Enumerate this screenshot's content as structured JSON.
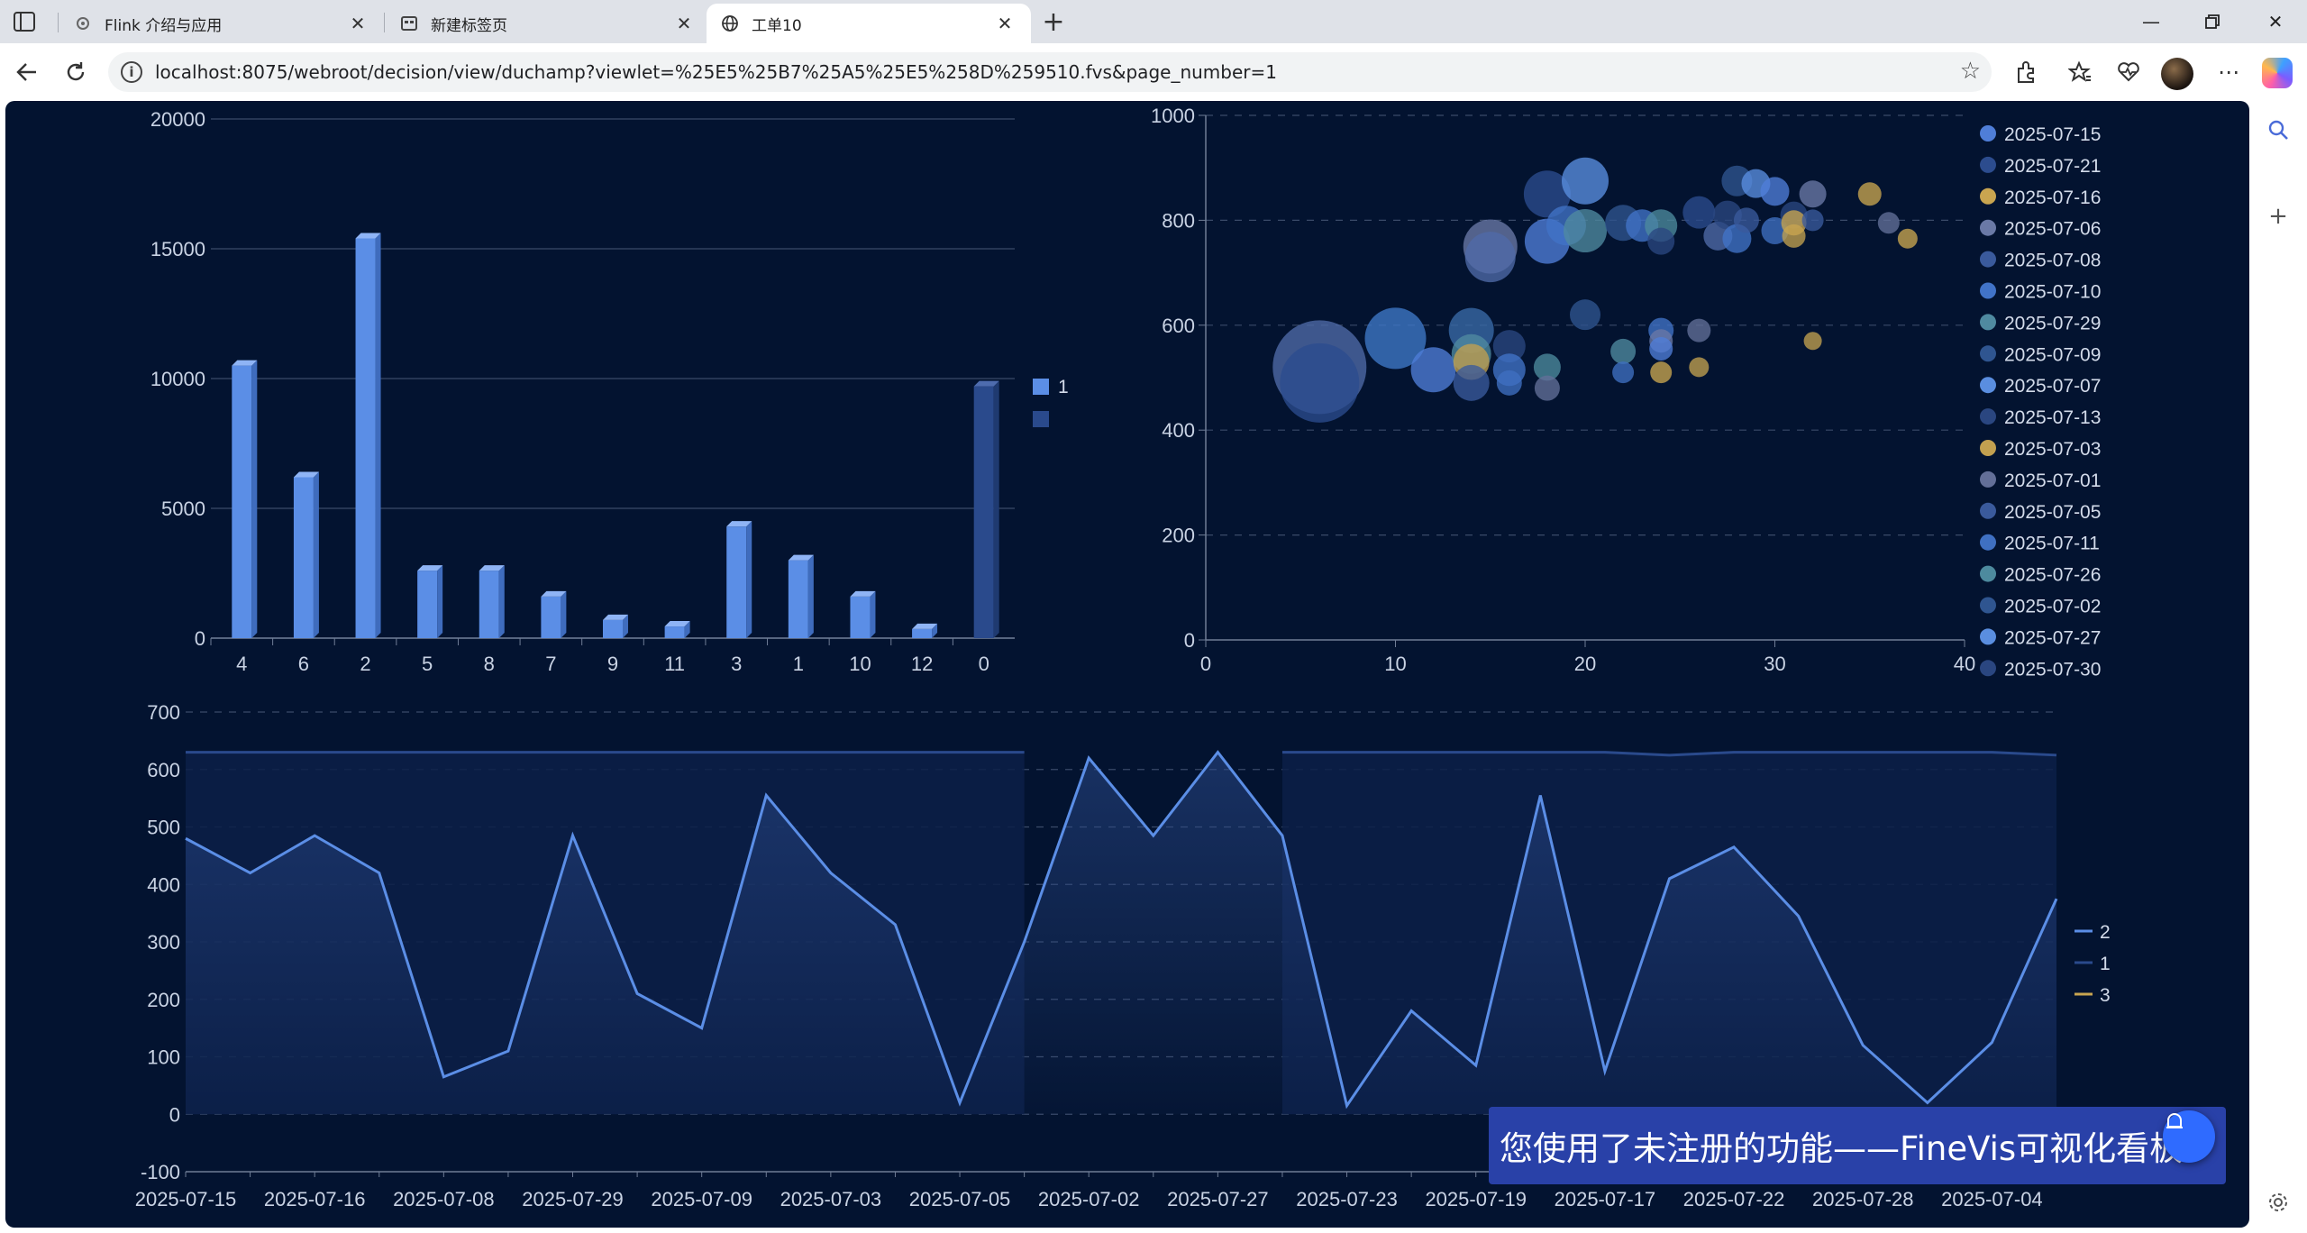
{
  "browser": {
    "tabs": [
      {
        "title": "Flink 介绍与应用",
        "icon": "gear-icon"
      },
      {
        "title": "新建标签页",
        "icon": "newtab-icon"
      },
      {
        "title": "工单10",
        "icon": "globe-icon"
      }
    ],
    "url": "localhost:8075/webroot/decision/view/duchamp?viewlet=%25E5%25B7%25A5%25E5%258D%259510.fvs&page_number=1"
  },
  "watermark": {
    "text": "您使用了未注册的功能——FineVis可视化看板"
  },
  "colors": {
    "background": "#031330",
    "accent": "#5b8ee6",
    "dark_series": "#2a4a8c",
    "gold": "#c9a550"
  },
  "chart_data": [
    {
      "type": "bar",
      "categories": [
        "4",
        "6",
        "2",
        "5",
        "8",
        "7",
        "9",
        "11",
        "3",
        "1",
        "10",
        "12",
        "0"
      ],
      "series": [
        {
          "name": "1",
          "values": [
            10500,
            6200,
            15400,
            2600,
            2600,
            1600,
            700,
            450,
            4300,
            3000,
            1600,
            350,
            null
          ],
          "color": "#5b8ee6"
        },
        {
          "name": "",
          "values": [
            null,
            null,
            null,
            null,
            null,
            null,
            null,
            null,
            null,
            null,
            null,
            null,
            9700
          ],
          "color": "#2a4a8c"
        }
      ],
      "yticks": [
        0,
        5000,
        10000,
        15000,
        20000
      ],
      "ylim": [
        0,
        20000
      ]
    },
    {
      "type": "scatter",
      "xticks": [
        0,
        10,
        20,
        30,
        40
      ],
      "yticks": [
        0,
        200,
        400,
        600,
        800,
        1000
      ],
      "xlim": [
        0,
        40
      ],
      "ylim": [
        0,
        1000
      ],
      "legend": [
        {
          "name": "2025-07-15",
          "color": "#4f7ed8"
        },
        {
          "name": "2025-07-21",
          "color": "#2c4c8e"
        },
        {
          "name": "2025-07-16",
          "color": "#c9a550"
        },
        {
          "name": "2025-07-06",
          "color": "#6a79a6"
        },
        {
          "name": "2025-07-08",
          "color": "#3a5a9c"
        },
        {
          "name": "2025-07-10",
          "color": "#4173c8"
        },
        {
          "name": "2025-07-29",
          "color": "#4f8aa0"
        },
        {
          "name": "2025-07-09",
          "color": "#2f5590"
        },
        {
          "name": "2025-07-07",
          "color": "#5a8ee0"
        },
        {
          "name": "2025-07-13",
          "color": "#2a4680"
        },
        {
          "name": "2025-07-03",
          "color": "#c2a050"
        },
        {
          "name": "2025-07-01",
          "color": "#636f98"
        },
        {
          "name": "2025-07-05",
          "color": "#3a5a9c"
        },
        {
          "name": "2025-07-11",
          "color": "#3f70c2"
        },
        {
          "name": "2025-07-26",
          "color": "#4d8a9e"
        },
        {
          "name": "2025-07-02",
          "color": "#2f5590"
        },
        {
          "name": "2025-07-27",
          "color": "#5a8ee0"
        },
        {
          "name": "2025-07-30",
          "color": "#2a4680"
        }
      ],
      "points": [
        {
          "x": 6,
          "y": 520,
          "s": 52,
          "c": "#4f6aa8"
        },
        {
          "x": 6,
          "y": 490,
          "s": 44,
          "c": "#2c4c8e"
        },
        {
          "x": 10,
          "y": 575,
          "s": 34,
          "c": "#3f78c8"
        },
        {
          "x": 12,
          "y": 515,
          "s": 25,
          "c": "#4f7ed8"
        },
        {
          "x": 14,
          "y": 590,
          "s": 25,
          "c": "#3a6aa8"
        },
        {
          "x": 14,
          "y": 545,
          "s": 22,
          "c": "#4f8aa0"
        },
        {
          "x": 14,
          "y": 530,
          "s": 20,
          "c": "#c2a050"
        },
        {
          "x": 14,
          "y": 490,
          "s": 20,
          "c": "#3a5a9c"
        },
        {
          "x": 16,
          "y": 560,
          "s": 18,
          "c": "#2a4680"
        },
        {
          "x": 16,
          "y": 515,
          "s": 18,
          "c": "#4173c8"
        },
        {
          "x": 16,
          "y": 490,
          "s": 14,
          "c": "#3f70c2"
        },
        {
          "x": 18,
          "y": 520,
          "s": 15,
          "c": "#4d8a9e"
        },
        {
          "x": 18,
          "y": 480,
          "s": 14,
          "c": "#636f98"
        },
        {
          "x": 15,
          "y": 750,
          "s": 30,
          "c": "#6a79a6"
        },
        {
          "x": 15,
          "y": 730,
          "s": 28,
          "c": "#4f6aa8"
        },
        {
          "x": 18,
          "y": 850,
          "s": 26,
          "c": "#2c4c8e"
        },
        {
          "x": 18,
          "y": 760,
          "s": 25,
          "c": "#4f7ed8"
        },
        {
          "x": 20,
          "y": 875,
          "s": 26,
          "c": "#5a8ee0"
        },
        {
          "x": 19,
          "y": 790,
          "s": 22,
          "c": "#4173c8"
        },
        {
          "x": 20,
          "y": 780,
          "s": 24,
          "c": "#4f8aa0"
        },
        {
          "x": 20,
          "y": 620,
          "s": 17,
          "c": "#2f5590"
        },
        {
          "x": 22,
          "y": 795,
          "s": 20,
          "c": "#2f5590"
        },
        {
          "x": 23,
          "y": 790,
          "s": 18,
          "c": "#4173c8"
        },
        {
          "x": 24,
          "y": 790,
          "s": 18,
          "c": "#4d8a9e"
        },
        {
          "x": 24,
          "y": 760,
          "s": 15,
          "c": "#2a4680"
        },
        {
          "x": 22,
          "y": 550,
          "s": 14,
          "c": "#4f8aa0"
        },
        {
          "x": 22,
          "y": 510,
          "s": 12,
          "c": "#3f70c2"
        },
        {
          "x": 24,
          "y": 590,
          "s": 14,
          "c": "#4173c8"
        },
        {
          "x": 24,
          "y": 570,
          "s": 13,
          "c": "#6a79a6"
        },
        {
          "x": 24,
          "y": 555,
          "s": 13,
          "c": "#4f7ed8"
        },
        {
          "x": 24,
          "y": 510,
          "s": 12,
          "c": "#c9a550"
        },
        {
          "x": 26,
          "y": 590,
          "s": 13,
          "c": "#636f98"
        },
        {
          "x": 26,
          "y": 520,
          "s": 11,
          "c": "#c2a050"
        },
        {
          "x": 26,
          "y": 815,
          "s": 18,
          "c": "#2c4c8e"
        },
        {
          "x": 27,
          "y": 770,
          "s": 16,
          "c": "#4f6aa8"
        },
        {
          "x": 27.5,
          "y": 810,
          "s": 16,
          "c": "#2a4680"
        },
        {
          "x": 28,
          "y": 875,
          "s": 17,
          "c": "#2f5590"
        },
        {
          "x": 28,
          "y": 765,
          "s": 16,
          "c": "#4173c8"
        },
        {
          "x": 28.5,
          "y": 800,
          "s": 14,
          "c": "#3a5a9c"
        },
        {
          "x": 29,
          "y": 870,
          "s": 16,
          "c": "#5a8ee0"
        },
        {
          "x": 30,
          "y": 855,
          "s": 16,
          "c": "#4f7ed8"
        },
        {
          "x": 30,
          "y": 780,
          "s": 15,
          "c": "#3f70c2"
        },
        {
          "x": 31,
          "y": 810,
          "s": 15,
          "c": "#2a4680"
        },
        {
          "x": 31,
          "y": 770,
          "s": 13,
          "c": "#c2a050"
        },
        {
          "x": 31,
          "y": 795,
          "s": 14,
          "c": "#c9a550"
        },
        {
          "x": 32,
          "y": 850,
          "s": 15,
          "c": "#6a79a6"
        },
        {
          "x": 32,
          "y": 800,
          "s": 12,
          "c": "#3a5a9c"
        },
        {
          "x": 32,
          "y": 570,
          "s": 10,
          "c": "#c2a050"
        },
        {
          "x": 35,
          "y": 850,
          "s": 13,
          "c": "#c9a550"
        },
        {
          "x": 36,
          "y": 795,
          "s": 12,
          "c": "#636f98"
        },
        {
          "x": 37,
          "y": 765,
          "s": 11,
          "c": "#c9a550"
        }
      ]
    },
    {
      "type": "area",
      "categories": [
        "2025-07-15",
        "2025-07-16",
        "2025-07-08",
        "2025-07-29",
        "2025-07-09",
        "2025-07-03",
        "2025-07-05",
        "2025-07-02",
        "2025-07-27",
        "2025-07-23",
        "2025-07-19",
        "2025-07-17",
        "2025-07-22",
        "2025-07-28",
        "2025-07-04"
      ],
      "x": [
        "2025-07-15",
        "",
        "2025-07-16",
        "",
        "2025-07-08",
        "",
        "2025-07-29",
        "",
        "2025-07-09",
        "",
        "2025-07-03",
        "",
        "2025-07-05",
        "",
        "2025-07-02",
        "",
        "2025-07-27",
        "",
        "2025-07-23",
        "",
        "2025-07-19",
        "",
        "2025-07-17",
        "",
        "2025-07-22",
        "",
        "2025-07-28",
        "",
        "2025-07-04",
        "",
        ""
      ],
      "yticks": [
        -100,
        0,
        100,
        200,
        300,
        400,
        500,
        600,
        700
      ],
      "ylim": [
        -100,
        700
      ],
      "legend": [
        {
          "name": "2",
          "color": "#5b8ee6"
        },
        {
          "name": "1",
          "color": "#2a4a8c"
        },
        {
          "name": "3",
          "color": "#c9a550"
        }
      ],
      "series": [
        {
          "name": "2",
          "values": [
            480,
            420,
            485,
            420,
            65,
            110,
            485,
            210,
            150,
            555,
            420,
            330,
            20,
            300,
            620,
            485,
            630,
            485,
            15,
            180,
            85,
            555,
            75,
            410,
            465,
            345,
            120,
            20,
            125,
            375
          ]
        },
        {
          "name": "1",
          "values": [
            630,
            630,
            630,
            630,
            630,
            630,
            630,
            630,
            630,
            630,
            630,
            630,
            630,
            630,
            null,
            null,
            null,
            630,
            630,
            630,
            630,
            630,
            630,
            625,
            630,
            630,
            630,
            630,
            630,
            625
          ]
        }
      ]
    }
  ]
}
